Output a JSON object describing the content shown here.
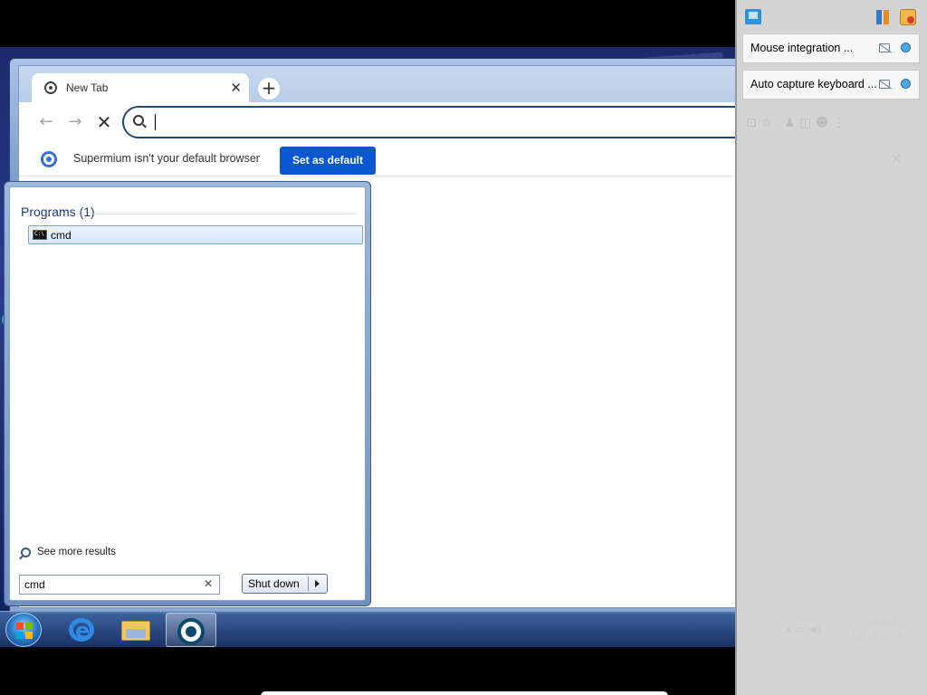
{
  "browser": {
    "tab": {
      "title": "New Tab",
      "close_glyph": "✕"
    },
    "new_tab_glyph": "+",
    "nav": {
      "back_glyph": "←",
      "forward_glyph": "→",
      "stop_glyph": "✕"
    },
    "omnibox": {
      "value": ""
    },
    "infobar": {
      "message": "Supermium isn't your default browser",
      "button_label": "Set as default"
    }
  },
  "start_menu": {
    "programs_header": "Programs (1)",
    "results": [
      {
        "label": "cmd",
        "icon": "cmd-icon"
      }
    ],
    "see_more_label": "See more results",
    "search": {
      "value": "cmd",
      "clear_glyph": "✕"
    },
    "shutdown_label": "Shut down"
  },
  "taskbar": {
    "items": [
      {
        "icon": "start-orb-icon"
      },
      {
        "icon": "internet-explorer-icon"
      },
      {
        "icon": "file-explorer-icon"
      },
      {
        "icon": "supermium-icon",
        "active": true
      }
    ]
  },
  "tray": {
    "time": "7:08 AM",
    "date": "10/13/2024"
  },
  "vbox_panel": {
    "notifications": [
      {
        "label": "Mouse integration ..."
      },
      {
        "label": "Auto capture keyboard ..."
      }
    ]
  }
}
